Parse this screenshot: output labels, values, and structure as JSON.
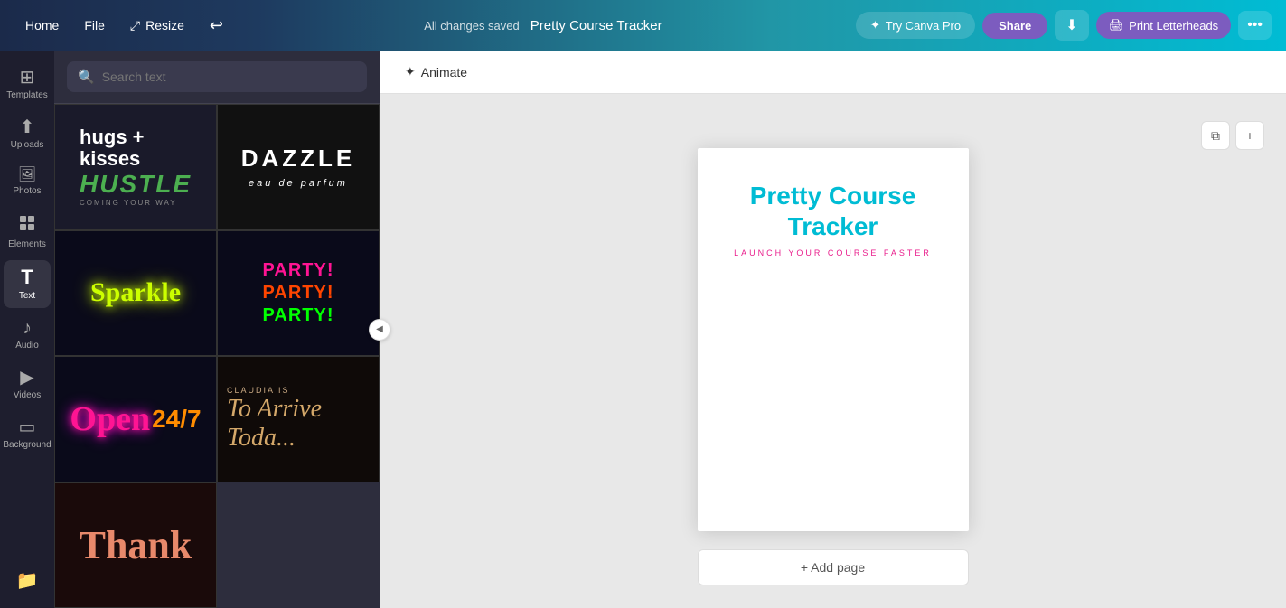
{
  "toolbar": {
    "home_label": "Home",
    "file_label": "File",
    "resize_label": "Resize",
    "undo_label": "↩",
    "changes_saved": "All changes saved",
    "doc_title": "Pretty Course Tracker",
    "try_canva_pro": "Try Canva Pro",
    "share_label": "Share",
    "download_icon": "⬇",
    "print_label": "Print Letterheads",
    "more_icon": "•••"
  },
  "sidebar": {
    "items": [
      {
        "id": "templates",
        "icon": "⊞",
        "label": "Templates"
      },
      {
        "id": "uploads",
        "icon": "⬆",
        "label": "Uploads"
      },
      {
        "id": "photos",
        "icon": "🖼",
        "label": "Photos"
      },
      {
        "id": "elements",
        "icon": "◈",
        "label": "Elements"
      },
      {
        "id": "text",
        "icon": "T",
        "label": "Text"
      },
      {
        "id": "audio",
        "icon": "♪",
        "label": "Audio"
      },
      {
        "id": "videos",
        "icon": "▶",
        "label": "Videos"
      },
      {
        "id": "background",
        "icon": "▭",
        "label": "Background"
      },
      {
        "id": "projects",
        "icon": "📁",
        "label": ""
      }
    ]
  },
  "search": {
    "placeholder": "Search text",
    "icon": "🔍"
  },
  "tiles": [
    {
      "id": "hugs-kisses",
      "type": "hugs"
    },
    {
      "id": "dazzle",
      "type": "dazzle"
    },
    {
      "id": "sparkle",
      "type": "sparkle"
    },
    {
      "id": "party",
      "type": "party"
    },
    {
      "id": "open",
      "type": "open"
    },
    {
      "id": "claudia",
      "type": "claudia"
    },
    {
      "id": "thank",
      "type": "thank"
    }
  ],
  "animate_btn": "Animate",
  "canvas": {
    "page_title_line1": "Pretty Course",
    "page_title_line2": "Tracker",
    "page_subtitle": "LAUNCH YOUR COURSE FASTER",
    "add_page": "+ Add page"
  },
  "colors": {
    "accent_cyan": "#00bcd4",
    "accent_pink": "#e91e8c",
    "toolbar_gradient_start": "#1b2a4a",
    "toolbar_gradient_end": "#00bcd4",
    "sidebar_bg": "#1e1e2e",
    "panel_bg": "#2d2d3d"
  }
}
